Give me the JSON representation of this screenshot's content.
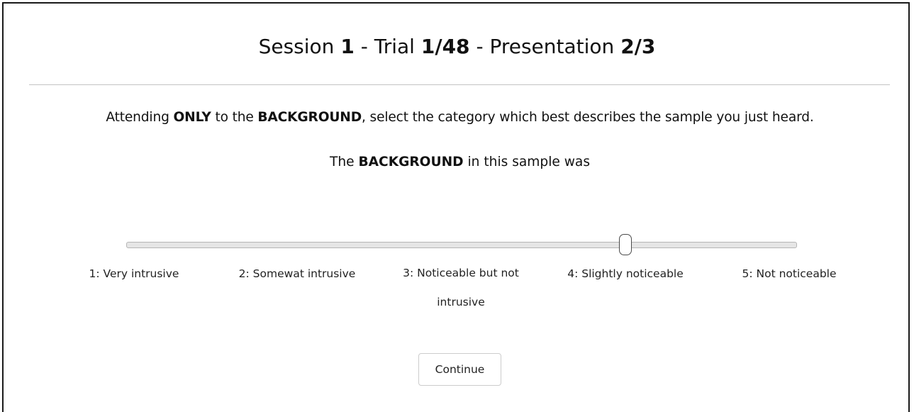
{
  "header": {
    "session_label": "Session",
    "session_value": "1",
    "trial_label": " - Trial ",
    "trial_value": "1/48",
    "presentation_label": " - Presentation ",
    "presentation_value": "2/3"
  },
  "instruction": {
    "part1": "Attending ",
    "emph1": "ONLY",
    "part2": " to the ",
    "emph2": "BACKGROUND",
    "part3": ", select the category which best describes the sample you just heard."
  },
  "question": {
    "part1": "The ",
    "emph": "BACKGROUND",
    "part2": " in this sample was"
  },
  "slider": {
    "min": 1,
    "max": 5,
    "value": 4,
    "labels": [
      "1: Very intrusive",
      "2: Somewat intrusive",
      "3: Noticeable but not intrusive",
      "4: Slightly noticeable",
      "5: Not noticeable"
    ]
  },
  "actions": {
    "continue_label": "Continue"
  }
}
